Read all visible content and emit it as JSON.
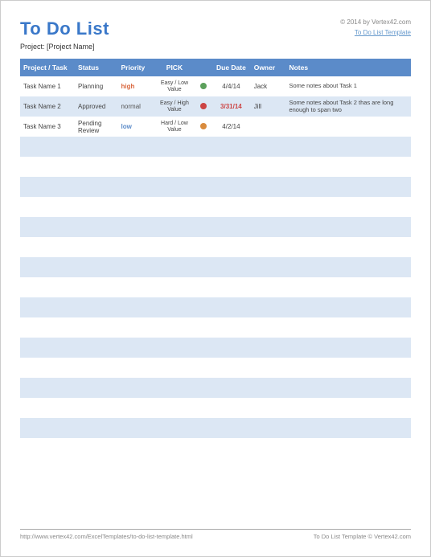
{
  "header": {
    "title": "To Do List",
    "copyright": "© 2014 by Vertex42.com",
    "template_link": "To Do List Template",
    "project_label": "Project:",
    "project_name": "[Project Name]"
  },
  "columns": {
    "task": "Project / Task",
    "status": "Status",
    "priority": "Priority",
    "pick": "PICK",
    "due": "Due Date",
    "owner": "Owner",
    "notes": "Notes"
  },
  "rows": [
    {
      "task": "Task Name 1",
      "status": "Planning",
      "priority": "high",
      "priority_class": "pri-high",
      "pick": "Easy / Low Value",
      "dot": "dot-green",
      "due": "4/4/14",
      "due_class": "",
      "owner": "Jack",
      "notes": "Some notes about Task 1"
    },
    {
      "task": "Task Name 2",
      "status": "Approved",
      "priority": "normal",
      "priority_class": "pri-normal",
      "pick": "Easy / High Value",
      "dot": "dot-red",
      "due": "3/31/14",
      "due_class": "due-red",
      "owner": "Jill",
      "notes": "Some notes about Task 2 thas are long enough to span two"
    },
    {
      "task": "Task Name 3",
      "status": "Pending Review",
      "priority": "low",
      "priority_class": "pri-low",
      "pick": "Hard / Low Value",
      "dot": "dot-orange",
      "due": "4/2/14",
      "due_class": "",
      "owner": "",
      "notes": ""
    }
  ],
  "empty_rows": 16,
  "footer": {
    "url": "http://www.vertex42.com/ExcelTemplates/to-do-list-template.html",
    "credit": "To Do List Template © Vertex42.com"
  }
}
